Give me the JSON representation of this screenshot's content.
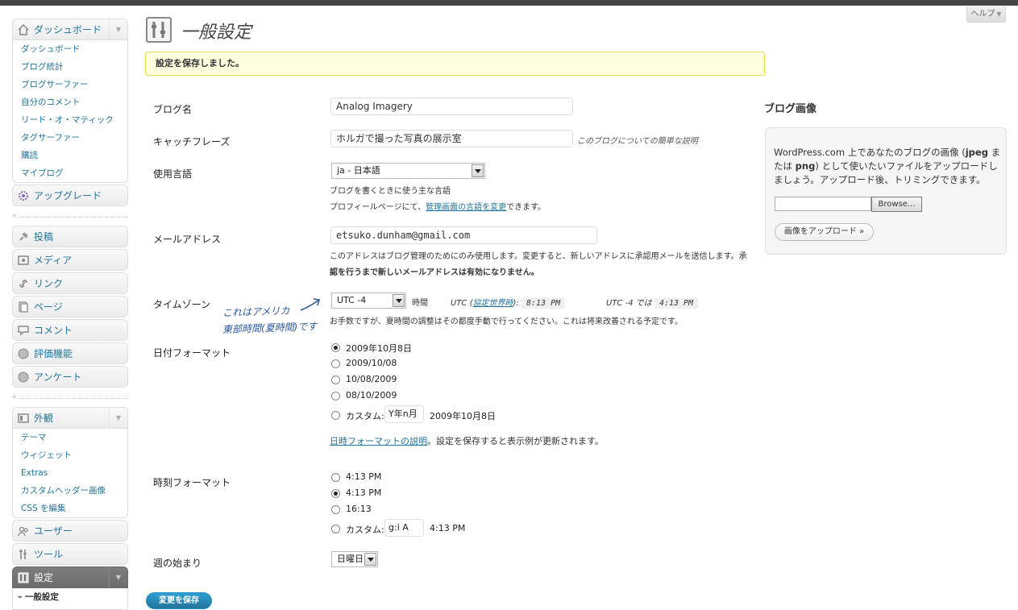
{
  "help": {
    "label": "ヘルプ"
  },
  "sidebar": {
    "dashboard": {
      "label": "ダッシュボード",
      "items": [
        "ダッシュボード",
        "ブログ統計",
        "ブログサーファー",
        "自分のコメント",
        "リード・オ・マティック",
        "タグサーファー",
        "購読",
        "マイブログ"
      ]
    },
    "upgrade": "アップグレード",
    "posts": "投稿",
    "media": "メディア",
    "links": "リンク",
    "pages": "ページ",
    "comments": "コメント",
    "ratings": "評価機能",
    "polls": "アンケート",
    "appearance": {
      "label": "外観",
      "items": [
        "テーマ",
        "ウィジェット",
        "Extras",
        "カスタムヘッダー画像",
        "CSS を編集"
      ]
    },
    "users": "ユーザー",
    "tools": "ツール",
    "settings": {
      "label": "設定",
      "items": [
        "一般設定"
      ]
    }
  },
  "page": {
    "title": "一般設定",
    "notice": "設定を保存しました。"
  },
  "form": {
    "blog_name": {
      "label": "ブログ名",
      "value": "Analog Imagery"
    },
    "tagline": {
      "label": "キャッチフレーズ",
      "value": "ホルガで撮った写真の展示室",
      "hint": "このブログについての簡単な説明"
    },
    "language": {
      "label": "使用言語",
      "value": "ja - 日本語",
      "hint1": "ブログを書くときに使う主な言語",
      "hint2_pre": "プロフィールページにて、",
      "hint2_link": "管理画面の言語を変更",
      "hint2_post": "できます。"
    },
    "email": {
      "label": "メールアドレス",
      "value": "etsuko.dunham@gmail.com",
      "hint1": "このアドレスはブログ管理のためにのみ使用します。変更すると、新しいアドレスに承認用メールを送信します。承",
      "hint2": "認を行うまで新しいメールアドレスは有効になりません。"
    },
    "timezone": {
      "label": "タイムゾーン",
      "value": "UTC -4",
      "unit": "時間",
      "utc_pre": "UTC (",
      "utc_link": "協定世界時",
      "utc_post": "):",
      "utc_time": "8:13 PM",
      "local_pre": "UTC -4 では",
      "local_time": "4:13 PM",
      "note": "お手数ですが、夏時間の調整はその都度手動で行ってください。これは将来改善される予定です。",
      "handwritten1": "これはアメリカ",
      "handwritten2": "東部時間(夏時間)です"
    },
    "date_format": {
      "label": "日付フォーマット",
      "options": [
        "2009年10月8日",
        "2009/10/08",
        "10/08/2009",
        "08/10/2009"
      ],
      "custom_label": "カスタム:",
      "custom_value": "Y年n月",
      "custom_preview": "2009年10月8日",
      "doc_link": "日時フォーマットの説明",
      "doc_post": "。設定を保存すると表示例が更新されます。"
    },
    "time_format": {
      "label": "時刻フォーマット",
      "options": [
        "4:13 PM",
        "4:13 PM",
        "16:13"
      ],
      "custom_label": "カスタム:",
      "custom_value": "g:i A",
      "custom_preview": "4:13 PM"
    },
    "week_start": {
      "label": "週の始まり",
      "value": "日曜日"
    },
    "save": "変更を保存"
  },
  "blog_image": {
    "title": "ブログ画像",
    "text_pre": "WordPress.com 上であなたのブログの画像 (",
    "jpeg": "jpeg",
    "text_mid": " または ",
    "png": "png",
    "text_post": ") として使いたいファイルをアップロードしましょう。アップロード後、トリミングできます。",
    "browse": "Browse...",
    "upload": "画像をアップロード »"
  }
}
